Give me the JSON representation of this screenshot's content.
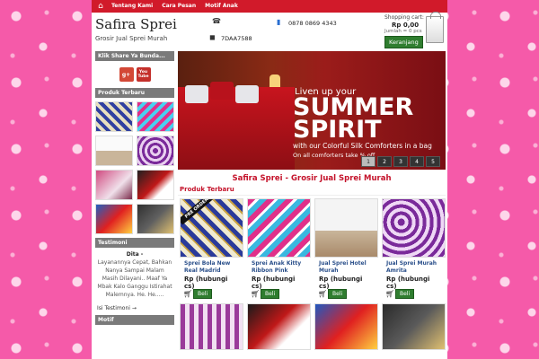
{
  "nav": {
    "items": [
      "Tentang Kami",
      "Cara Pesan",
      "Motif Anak"
    ]
  },
  "site": {
    "title": "Safira Sprei",
    "tagline": "Grosir Jual Sprei Murah"
  },
  "contact": {
    "phone": "0878 0869 4343",
    "bbm": "7DAA7588"
  },
  "cart": {
    "label": "Shopping cart:",
    "amount": "Rp 0,00",
    "qty": "Jumlah = 0 pcs",
    "button": "Keranjang"
  },
  "sidebar": {
    "share_title": "Klik Share Ya Bunda...",
    "social": [
      {
        "label": "g+"
      },
      {
        "label": "You Tube"
      }
    ],
    "products_title": "Produk Terbaru",
    "testimoni_title": "Testimoni",
    "testimoni_name": "Dita -",
    "testimoni_text": "Layanannya Cepat, Bahkan Nanya Sampai Malam Masih Dilayani.. Maaf Ya Mbak Kalo Ganggu Istirahat Malemnya. He. He.....",
    "more": "Isi Testimoni →",
    "motif_title": "Motif"
  },
  "slider": {
    "line1": "Liven up your",
    "line2a": "SUMMER",
    "line2b": "SPIRIT",
    "line3": "with our Colorful Silk Comforters in a bag",
    "line4": "On all comforters take   % off",
    "pages": [
      "1",
      "2",
      "3",
      "4",
      "5"
    ]
  },
  "main": {
    "title": "Safira Sprei - Grosir Jual Sprei Murah",
    "section": "Produk Terbaru"
  },
  "products": [
    {
      "name": "Sprei Bola New Real Madrid",
      "price": "Rp (hubungi cs)",
      "buy": "Beli",
      "badge": "PRE ORDER"
    },
    {
      "name": "Sprei Anak Kitty Ribbon Pink",
      "price": "Rp (hubungi cs)",
      "buy": "Beli"
    },
    {
      "name": "Jual Sprei Hotel Murah",
      "price": "Rp (hubungi cs)",
      "buy": "Beli"
    },
    {
      "name": "Jual Sprei Murah Amrita",
      "price": "Rp (hubungi cs)",
      "buy": "Beli"
    }
  ],
  "colors": {
    "nav_red": "#d11a2a",
    "buy_green": "#2f7d2f",
    "title_red": "#c4122a",
    "background_pink": "#f55aa9"
  },
  "icons": {
    "home": "home-icon",
    "phone": "phone-icon",
    "bbm": "bbm-icon",
    "cart": "cart-icon"
  }
}
